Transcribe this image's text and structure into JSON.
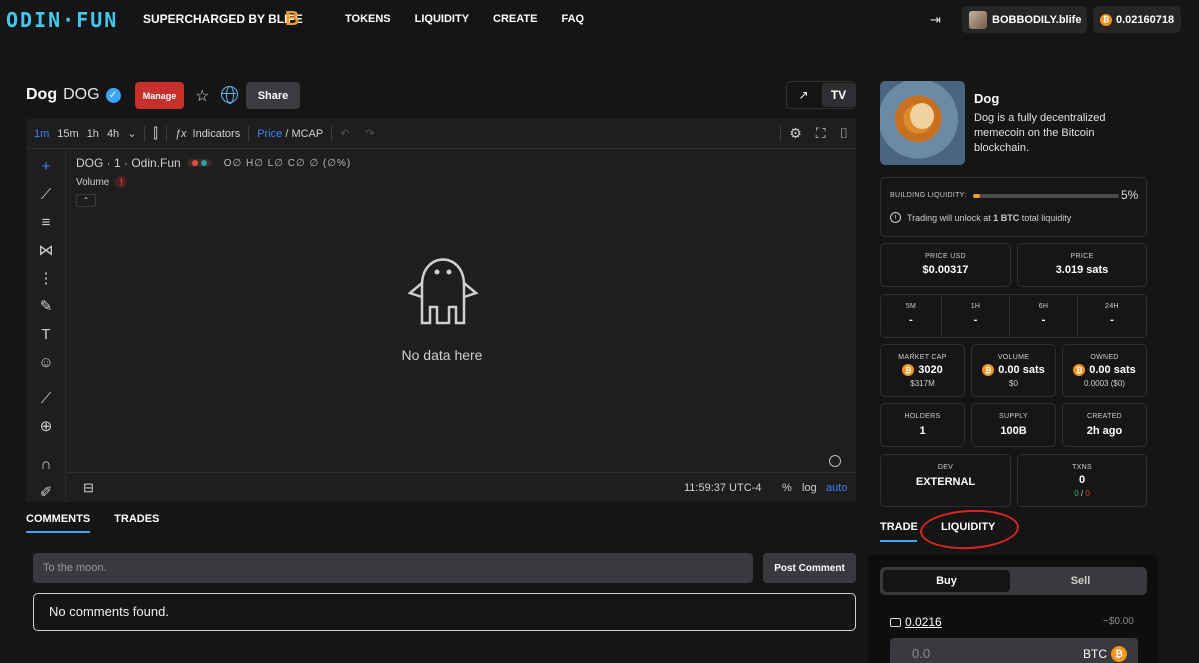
{
  "nav": {
    "logo": "ODIN·FUN",
    "tagline": "SUPERCHARGED BY BLIFE",
    "links": [
      "TOKENS",
      "LIQUIDITY",
      "CREATE",
      "FAQ"
    ],
    "username": "BOBBODILY.blife",
    "balance": "0.02160718"
  },
  "token": {
    "name": "Dog",
    "ticker": "DOG",
    "manage_label": "Manage",
    "share_label": "Share",
    "description": "Dog is a fully decentralized memecoin on the Bitcoin blockchain."
  },
  "chart_toolbar": {
    "timeframes": [
      "1m",
      "15m",
      "1h",
      "4h"
    ],
    "indicators_label": "Indicators",
    "price_label": "Price",
    "mcap_label": "MCAP",
    "legend_title": "DOG · 1 · Odin.Fun",
    "ohlc": "O∅ H∅ L∅ C∅ ∅ (∅%)",
    "volume_label": "Volume",
    "no_data": "No data here",
    "time": "11:59:37 UTC-4",
    "pct": "%",
    "log": "log",
    "auto": "auto"
  },
  "comments": {
    "tab_comments": "COMMENTS",
    "tab_trades": "TRADES",
    "placeholder": "To the moon.",
    "post_label": "Post Comment",
    "empty": "No comments found."
  },
  "liquidity": {
    "label": "BUILDING LIQUIDITY:",
    "percent": "5%",
    "fill_fraction": 0.05,
    "info_prefix": "Trading will unlock at ",
    "info_bold": "1 BTC",
    "info_suffix": " total liquidity"
  },
  "stats": {
    "price_usd_label": "PRICE USD",
    "price_usd": "$0.00317",
    "price_label": "PRICE",
    "price": "3.019 sats",
    "timeframes": [
      {
        "label": "5M",
        "value": "-"
      },
      {
        "label": "1H",
        "value": "-"
      },
      {
        "label": "6H",
        "value": "-"
      },
      {
        "label": "24H",
        "value": "-"
      }
    ],
    "mcap_label": "MARKET CAP",
    "mcap": "3020",
    "mcap_usd": "$317M",
    "volume_label": "VOLUME",
    "volume": "0.00 sats",
    "volume_usd": "$0",
    "owned_label": "OWNED",
    "owned": "0.00 sats",
    "owned_sub": "0.0003 ($0)",
    "holders_label": "HOLDERS",
    "holders": "1",
    "supply_label": "SUPPLY",
    "supply": "100B",
    "created_label": "CREATED",
    "created": "2h ago",
    "dev_label": "DEV",
    "dev": "EXTERNAL",
    "txns_label": "TXNS",
    "txns": "0",
    "txns_buys": "0",
    "txns_sep": "/",
    "txns_sells": "0"
  },
  "trade": {
    "tab_trade": "TRADE",
    "tab_liquidity": "LIQUIDITY",
    "buy_label": "Buy",
    "sell_label": "Sell",
    "wallet_amount": "0.0216",
    "usd_amount": "~$0.00",
    "amount_placeholder": "0.0",
    "currency": "BTC"
  },
  "colors": {
    "accent_blue": "#3aa6f5",
    "btc_orange": "#f7931a",
    "manage_red": "#c8302c",
    "annotation_red": "#d8261e"
  }
}
